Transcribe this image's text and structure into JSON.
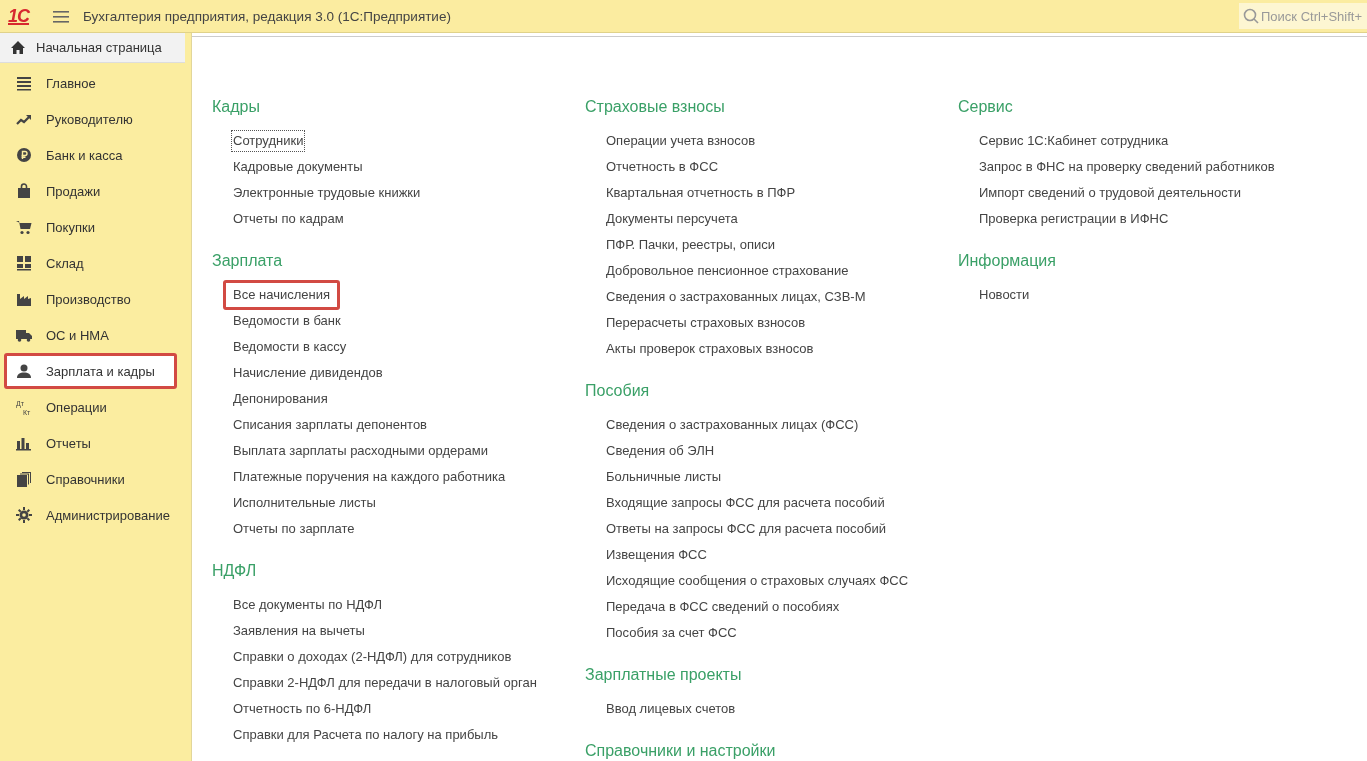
{
  "app_bar": {
    "logo": "1С",
    "title": "Бухгалтерия предприятия, редакция 3.0  (1С:Предприятие)",
    "search": {
      "placeholder": "Поиск Ctrl+Shift+"
    }
  },
  "home_tab": {
    "label": "Начальная страница",
    "selected": true
  },
  "sidebar": {
    "items": [
      {
        "label": "Главное",
        "selected": false,
        "highlighted": false
      },
      {
        "label": "Руководителю",
        "selected": false,
        "highlighted": false
      },
      {
        "label": "Банк и касса",
        "selected": false,
        "highlighted": false
      },
      {
        "label": "Продажи",
        "selected": false,
        "highlighted": false
      },
      {
        "label": "Покупки",
        "selected": false,
        "highlighted": false
      },
      {
        "label": "Склад",
        "selected": false,
        "highlighted": false
      },
      {
        "label": "Производство",
        "selected": false,
        "highlighted": false
      },
      {
        "label": "ОС и НМА",
        "selected": false,
        "highlighted": false
      },
      {
        "label": "Зарплата и кадры",
        "selected": true,
        "highlighted": true
      },
      {
        "label": "Операции",
        "selected": false,
        "highlighted": false,
        "icon_text": [
          "Дт",
          "Кт"
        ]
      },
      {
        "label": "Отчеты",
        "selected": false,
        "highlighted": false
      },
      {
        "label": "Справочники",
        "selected": false,
        "highlighted": false
      },
      {
        "label": "Администрирование",
        "selected": false,
        "highlighted": false
      }
    ]
  },
  "columns": [
    {
      "sections": [
        {
          "title": "Кадры",
          "links": [
            {
              "label": "Сотрудники",
              "focused": true,
              "highlighted": false
            },
            {
              "label": "Кадровые документы",
              "focused": false,
              "highlighted": false
            },
            {
              "label": "Электронные трудовые книжки",
              "focused": false,
              "highlighted": false
            },
            {
              "label": "Отчеты по кадрам",
              "focused": false,
              "highlighted": false
            }
          ]
        },
        {
          "title": "Зарплата",
          "links": [
            {
              "label": "Все начисления",
              "focused": false,
              "highlighted": true
            },
            {
              "label": "Ведомости в банк",
              "focused": false,
              "highlighted": false
            },
            {
              "label": "Ведомости в кассу",
              "focused": false,
              "highlighted": false
            },
            {
              "label": "Начисление дивидендов",
              "focused": false,
              "highlighted": false
            },
            {
              "label": "Депонирования",
              "focused": false,
              "highlighted": false
            },
            {
              "label": "Списания зарплаты депонентов",
              "focused": false,
              "highlighted": false
            },
            {
              "label": "Выплата зарплаты расходными ордерами",
              "focused": false,
              "highlighted": false
            },
            {
              "label": "Платежные поручения на каждого работника",
              "focused": false,
              "highlighted": false
            },
            {
              "label": "Исполнительные листы",
              "focused": false,
              "highlighted": false
            },
            {
              "label": "Отчеты по зарплате",
              "focused": false,
              "highlighted": false
            }
          ]
        },
        {
          "title": "НДФЛ",
          "links": [
            {
              "label": "Все документы по НДФЛ",
              "focused": false,
              "highlighted": false
            },
            {
              "label": "Заявления на вычеты",
              "focused": false,
              "highlighted": false
            },
            {
              "label": "Справки о доходах (2-НДФЛ) для сотрудников",
              "focused": false,
              "highlighted": false
            },
            {
              "label": "Справки 2-НДФЛ для передачи в налоговый орган",
              "focused": false,
              "highlighted": false
            },
            {
              "label": "Отчетность по 6-НДФЛ",
              "focused": false,
              "highlighted": false
            },
            {
              "label": "Справки для Расчета по налогу на прибыль",
              "focused": false,
              "highlighted": false
            }
          ]
        }
      ]
    },
    {
      "sections": [
        {
          "title": "Страховые взносы",
          "links": [
            {
              "label": "Операции учета взносов",
              "focused": false,
              "highlighted": false
            },
            {
              "label": "Отчетность в ФСС",
              "focused": false,
              "highlighted": false
            },
            {
              "label": "Квартальная отчетность в ПФР",
              "focused": false,
              "highlighted": false
            },
            {
              "label": "Документы персучета",
              "focused": false,
              "highlighted": false
            },
            {
              "label": "ПФР. Пачки, реестры, описи",
              "focused": false,
              "highlighted": false
            },
            {
              "label": "Добровольное пенсионное страхование",
              "focused": false,
              "highlighted": false
            },
            {
              "label": "Сведения о застрахованных лицах, СЗВ-М",
              "focused": false,
              "highlighted": false
            },
            {
              "label": "Перерасчеты страховых взносов",
              "focused": false,
              "highlighted": false
            },
            {
              "label": "Акты проверок страховых взносов",
              "focused": false,
              "highlighted": false
            }
          ]
        },
        {
          "title": "Пособия",
          "links": [
            {
              "label": "Сведения о застрахованных лицах (ФСС)",
              "focused": false,
              "highlighted": false
            },
            {
              "label": "Сведения об ЭЛН",
              "focused": false,
              "highlighted": false
            },
            {
              "label": "Больничные листы",
              "focused": false,
              "highlighted": false
            },
            {
              "label": "Входящие запросы ФСС для расчета пособий",
              "focused": false,
              "highlighted": false
            },
            {
              "label": "Ответы на запросы ФСС для расчета пособий",
              "focused": false,
              "highlighted": false
            },
            {
              "label": "Извещения ФСС",
              "focused": false,
              "highlighted": false
            },
            {
              "label": "Исходящие сообщения о страховых случаях ФСС",
              "focused": false,
              "highlighted": false
            },
            {
              "label": "Передача в ФСС сведений о пособиях",
              "focused": false,
              "highlighted": false
            },
            {
              "label": "Пособия за счет ФСС",
              "focused": false,
              "highlighted": false
            }
          ]
        },
        {
          "title": "Зарплатные проекты",
          "links": [
            {
              "label": "Ввод лицевых счетов",
              "focused": false,
              "highlighted": false
            }
          ]
        },
        {
          "title": "Справочники и настройки"
        }
      ]
    },
    {
      "sections": [
        {
          "title": "Сервис",
          "links": [
            {
              "label": "Сервис 1С:Кабинет сотрудника",
              "focused": false,
              "highlighted": false
            },
            {
              "label": "Запрос в ФНС на проверку сведений работников",
              "focused": false,
              "highlighted": false
            },
            {
              "label": "Импорт сведений о трудовой деятельности",
              "focused": false,
              "highlighted": false
            },
            {
              "label": "Проверка регистрации в ИФНС",
              "focused": false,
              "highlighted": false
            }
          ]
        },
        {
          "title": "Информация",
          "links": [
            {
              "label": "Новости",
              "focused": false,
              "highlighted": false
            }
          ]
        }
      ]
    }
  ]
}
